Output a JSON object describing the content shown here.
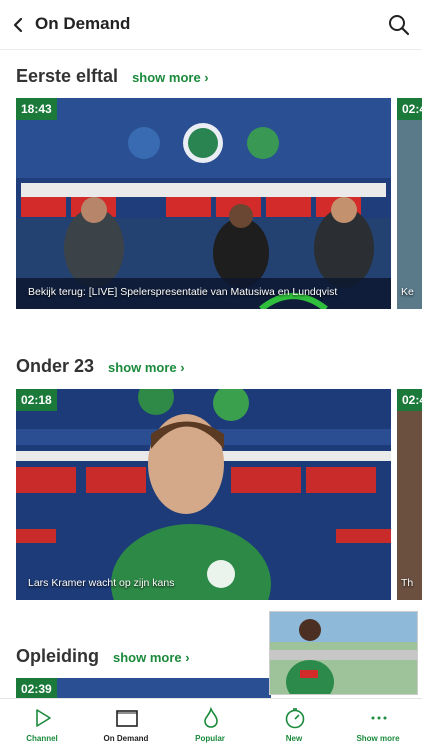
{
  "header": {
    "title": "On Demand"
  },
  "sections": [
    {
      "title": "Eerste elftal",
      "show_more": "show more",
      "items": [
        {
          "duration": "18:43",
          "caption": "Bekijk terug: [LIVE] Spelerspresentatie van Matusiwa en Lundqvist"
        },
        {
          "duration": "02:4",
          "caption": "Ke"
        }
      ]
    },
    {
      "title": "Onder 23",
      "show_more": "show more",
      "items": [
        {
          "duration": "02:18",
          "caption": "Lars Kramer wacht op zijn kans"
        },
        {
          "duration": "02:4",
          "caption": "Th"
        }
      ]
    },
    {
      "title": "Opleiding",
      "show_more": "show more",
      "items": [
        {
          "duration": "02:39",
          "caption": ""
        }
      ]
    }
  ],
  "tabbar": [
    {
      "label": "Channel",
      "icon": "play-icon"
    },
    {
      "label": "On Demand",
      "icon": "tv-icon"
    },
    {
      "label": "Popular",
      "icon": "flame-icon"
    },
    {
      "label": "New",
      "icon": "stopwatch-icon"
    },
    {
      "label": "Show more",
      "icon": "dots-icon"
    }
  ],
  "colors": {
    "accent": "#1b8a3c",
    "duration_bg": "#1b7a3a"
  }
}
